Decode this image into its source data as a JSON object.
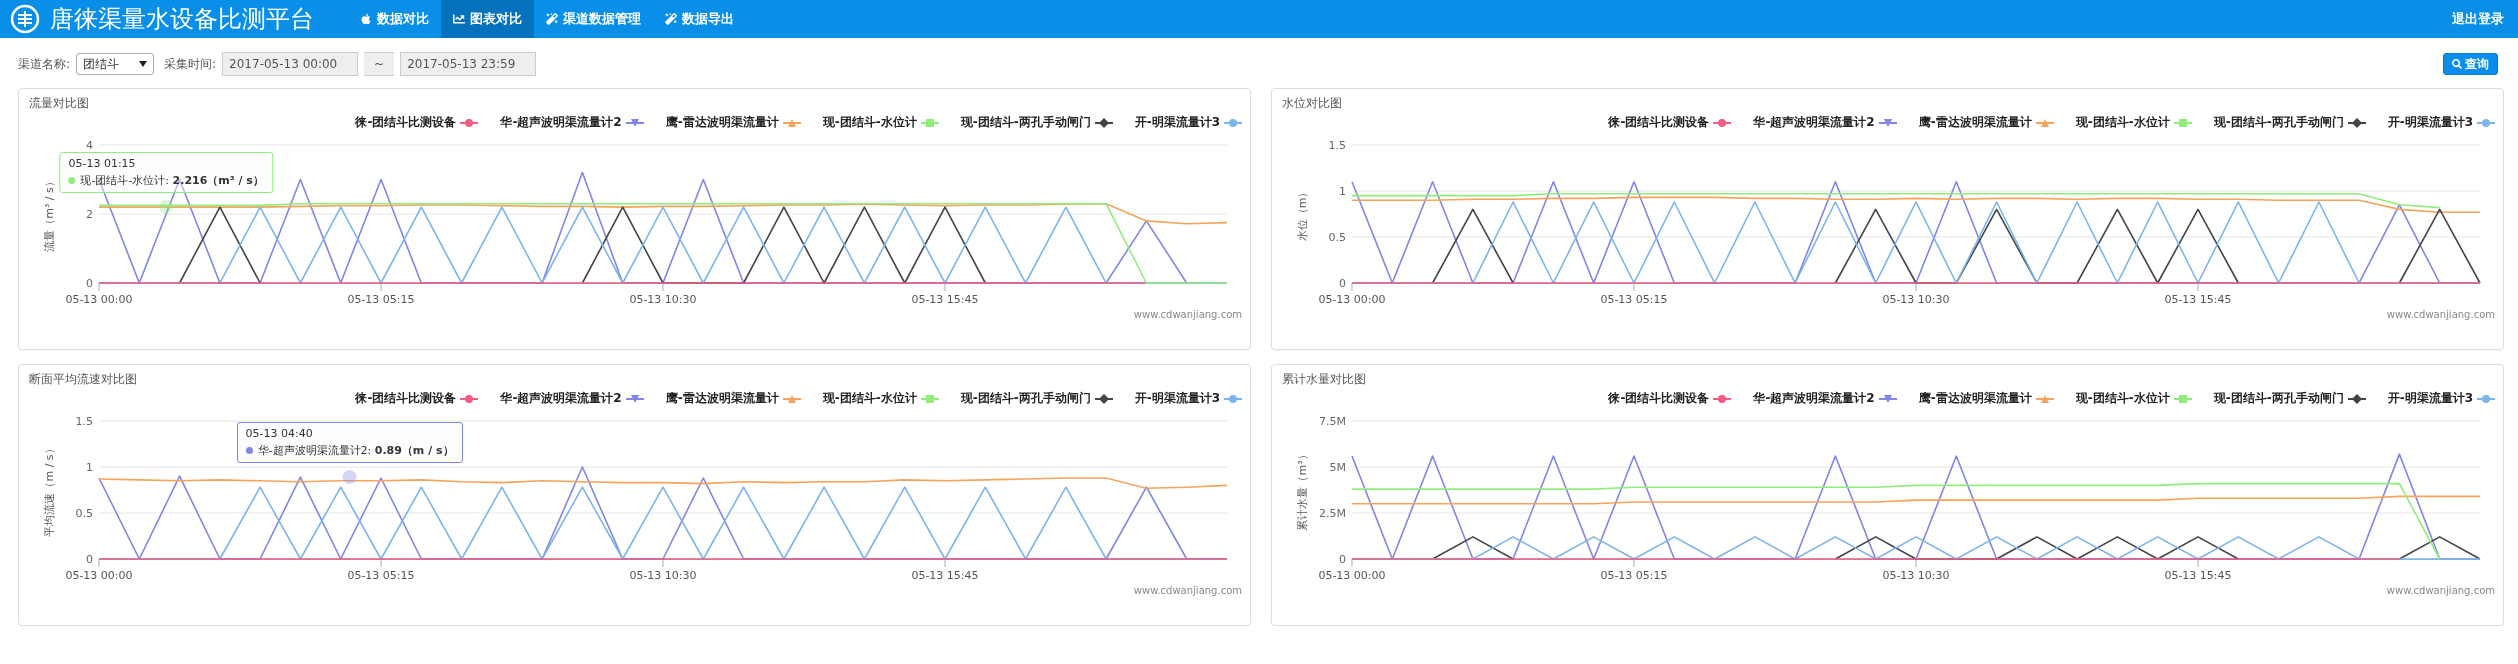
{
  "header": {
    "title": "唐徕渠量水设备比测平台",
    "nav": [
      {
        "label": "数据对比",
        "selected": false
      },
      {
        "label": "图表对比",
        "selected": true
      },
      {
        "label": "渠道数据管理",
        "selected": false
      },
      {
        "label": "数据导出",
        "selected": false
      }
    ],
    "logout": "退出登录"
  },
  "filters": {
    "channel_label": "渠道名称:",
    "channel_value": "团结斗",
    "time_label": "采集时间:",
    "start": "2017-05-13 00:00",
    "separator": "~",
    "end": "2017-05-13 23:59",
    "query_button": "查询"
  },
  "panels": [
    {
      "title": "流量对比图",
      "credits": "www.cdwanjiang.com",
      "tooltip": {
        "time": "05-13 01:15",
        "text": "现-团结斗-水位计: **2.216（m³ / s）**",
        "color": "#90ed7d"
      },
      "chart_data": {
        "type": "line",
        "ylabel": "流量（m³ / s）",
        "ylim": [
          0,
          4
        ],
        "yticks": [
          0,
          2,
          4
        ],
        "categories": [
          "05-13 00:00",
          null,
          null,
          null,
          null,
          null,
          null,
          "05-13 05:15",
          null,
          null,
          null,
          null,
          null,
          null,
          "05-13 10:30",
          null,
          null,
          null,
          null,
          null,
          null,
          "05-13 15:45",
          null,
          null,
          null,
          null,
          null,
          null,
          null
        ],
        "series": [
          {
            "name": "徕-团结斗比测设备",
            "color": "#f15c80",
            "values": [
              0,
              0,
              0,
              0,
              0,
              0,
              0,
              0,
              0,
              0,
              0,
              0,
              0,
              0,
              0,
              0,
              0,
              0,
              0,
              0,
              0,
              0,
              0,
              0,
              0,
              0,
              0,
              null,
              null
            ]
          },
          {
            "name": "华-超声波明渠流量计2",
            "color": "#8085e9",
            "values": [
              3,
              0,
              3,
              0,
              0,
              3,
              0,
              3,
              0,
              0,
              0,
              0,
              3.2,
              0,
              0,
              3,
              0,
              0,
              0,
              0,
              0,
              0,
              0,
              0,
              0,
              0,
              1.8,
              0,
              0
            ]
          },
          {
            "name": "鹰-雷达波明渠流量计",
            "color": "#f7a35c",
            "values": [
              2.2,
              2.2,
              2.2,
              2.2,
              2.2,
              2.22,
              2.24,
              2.24,
              2.26,
              2.26,
              2.24,
              2.22,
              2.22,
              2.2,
              2.22,
              2.22,
              2.24,
              2.26,
              2.26,
              2.28,
              2.26,
              2.24,
              2.26,
              2.26,
              2.28,
              2.3,
              1.8,
              1.72,
              1.75
            ]
          },
          {
            "name": "现-团结斗-水位计",
            "color": "#90ed7d",
            "values": [
              2.25,
              2.25,
              2.25,
              2.25,
              2.25,
              2.3,
              2.3,
              2.3,
              2.3,
              2.3,
              2.3,
              2.3,
              2.3,
              2.3,
              2.3,
              2.3,
              2.3,
              2.3,
              2.3,
              2.3,
              2.3,
              2.3,
              2.3,
              2.3,
              2.3,
              2.3,
              0,
              0,
              0
            ]
          },
          {
            "name": "现-团结斗-两孔手动闸门",
            "color": "#434348",
            "values": [
              null,
              null,
              0,
              2.2,
              0,
              null,
              null,
              null,
              null,
              null,
              null,
              null,
              0,
              2.2,
              0,
              0,
              0,
              2.2,
              0,
              2.2,
              0,
              2.2,
              0,
              null,
              null,
              null,
              null,
              null,
              null
            ]
          },
          {
            "name": "开-明渠流量计3",
            "color": "#7cb5ec",
            "values": [
              0,
              0,
              0,
              0,
              2.2,
              0,
              2.2,
              0,
              2.2,
              0,
              2.2,
              0,
              2.2,
              0,
              2.2,
              0,
              2.2,
              0,
              2.2,
              0,
              2.2,
              0,
              2.2,
              0,
              2.2,
              0,
              0,
              0,
              0
            ]
          }
        ]
      }
    },
    {
      "title": "水位对比图",
      "credits": "www.cdwanjiang.com",
      "chart_data": {
        "type": "line",
        "ylabel": "水位（m）",
        "ylim": [
          0,
          1.5
        ],
        "yticks": [
          0,
          0.5,
          1,
          1.5
        ],
        "categories": [
          "05-13 00:00",
          null,
          null,
          null,
          null,
          null,
          null,
          "05-13 05:15",
          null,
          null,
          null,
          null,
          null,
          null,
          "05-13 10:30",
          null,
          null,
          null,
          null,
          null,
          null,
          "05-13 15:45",
          null,
          null,
          null,
          null,
          null,
          null,
          null
        ],
        "series": [
          {
            "name": "徕-团结斗比测设备",
            "color": "#f15c80",
            "values": [
              0,
              0,
              0,
              0,
              0,
              0,
              0,
              0,
              0,
              0,
              0,
              0,
              0,
              0,
              0,
              0,
              0,
              0,
              0,
              0,
              0,
              0,
              0,
              0,
              0,
              0,
              0,
              0,
              0
            ]
          },
          {
            "name": "华-超声波明渠流量计2",
            "color": "#8085e9",
            "values": [
              1.1,
              0,
              1.1,
              0,
              0,
              1.1,
              0,
              1.1,
              0,
              0,
              0,
              0,
              1.1,
              0,
              0,
              1.1,
              0,
              0,
              0,
              0,
              0,
              0,
              0,
              0,
              0,
              0,
              0.85,
              0,
              0
            ]
          },
          {
            "name": "鹰-雷达波明渠流量计",
            "color": "#f7a35c",
            "values": [
              0.9,
              0.9,
              0.9,
              0.91,
              0.91,
              0.92,
              0.92,
              0.93,
              0.93,
              0.93,
              0.92,
              0.92,
              0.91,
              0.91,
              0.92,
              0.91,
              0.92,
              0.92,
              0.91,
              0.92,
              0.92,
              0.91,
              0.91,
              0.9,
              0.9,
              0.9,
              0.8,
              0.77,
              0.77
            ]
          },
          {
            "name": "现-团结斗-水位计",
            "color": "#90ed7d",
            "values": [
              0.95,
              0.95,
              0.95,
              0.95,
              0.95,
              0.97,
              0.97,
              0.97,
              0.97,
              0.97,
              0.97,
              0.97,
              0.97,
              0.97,
              0.97,
              0.97,
              0.97,
              0.97,
              0.97,
              0.97,
              0.97,
              0.97,
              0.97,
              0.97,
              0.97,
              0.97,
              0.85,
              0.82,
              null
            ]
          },
          {
            "name": "现-团结斗-两孔手动闸门",
            "color": "#434348",
            "values": [
              null,
              null,
              0,
              0.8,
              0,
              null,
              null,
              null,
              null,
              null,
              null,
              null,
              0,
              0.8,
              0,
              0,
              0.8,
              0,
              0,
              0.8,
              0,
              0.8,
              0,
              null,
              null,
              null,
              0,
              0.8,
              0
            ]
          },
          {
            "name": "开-明渠流量计3",
            "color": "#7cb5ec",
            "values": [
              0,
              0,
              0,
              0,
              0.88,
              0,
              0.88,
              0,
              0.88,
              0,
              0.88,
              0,
              0.88,
              0,
              0.88,
              0,
              0.88,
              0,
              0.88,
              0,
              0.88,
              0,
              0.88,
              0,
              0.88,
              0,
              0,
              0,
              0
            ]
          }
        ]
      }
    },
    {
      "title": "断面平均流速对比图",
      "credits": "www.cdwanjiang.com",
      "tooltip": {
        "time": "05-13 04:40",
        "text": "华-超声波明渠流量计2: **0.89（m / s）**",
        "color": "#8085e9"
      },
      "chart_data": {
        "type": "line",
        "ylabel": "平均流速（m / s）",
        "ylim": [
          0,
          1.5
        ],
        "yticks": [
          0,
          0.5,
          1,
          1.5
        ],
        "categories": [
          "05-13 00:00",
          null,
          null,
          null,
          null,
          null,
          null,
          "05-13 05:15",
          null,
          null,
          null,
          null,
          null,
          null,
          "05-13 10:30",
          null,
          null,
          null,
          null,
          null,
          null,
          "05-13 15:45",
          null,
          null,
          null,
          null,
          null,
          null,
          null
        ],
        "series": [
          {
            "name": "徕-团结斗比测设备",
            "color": "#f15c80",
            "values": [
              0,
              0,
              0,
              0,
              0,
              0,
              0,
              0,
              0,
              0,
              0,
              0,
              0,
              0,
              0,
              0,
              0,
              0,
              0,
              0,
              0,
              0,
              0,
              0,
              0,
              0,
              0,
              0,
              0
            ]
          },
          {
            "name": "华-超声波明渠流量计2",
            "color": "#8085e9",
            "values": [
              0.88,
              0,
              0.9,
              0,
              0,
              0.89,
              0,
              0.88,
              0,
              0,
              0,
              0,
              1,
              0,
              0,
              0.88,
              0,
              0,
              0,
              0,
              0,
              0,
              0,
              0,
              0,
              0,
              0.78,
              0,
              0
            ]
          },
          {
            "name": "鹰-雷达波明渠流量计",
            "color": "#f7a35c",
            "values": [
              0.87,
              0.86,
              0.85,
              0.86,
              0.85,
              0.84,
              0.85,
              0.85,
              0.86,
              0.84,
              0.83,
              0.85,
              0.84,
              0.83,
              0.83,
              0.82,
              0.84,
              0.83,
              0.84,
              0.84,
              0.86,
              0.85,
              0.86,
              0.87,
              0.88,
              0.88,
              0.77,
              0.78,
              0.8
            ]
          },
          {
            "name": "现-团结斗-水位计",
            "color": "#90ed7d",
            "values": [
              null,
              null,
              null,
              null,
              null,
              null,
              null,
              null,
              null,
              null,
              null,
              null,
              null,
              null,
              null,
              null,
              null,
              null,
              null,
              null,
              null,
              null,
              null,
              null,
              null,
              null,
              null,
              null,
              null
            ]
          },
          {
            "name": "现-团结斗-两孔手动闸门",
            "color": "#434348",
            "values": [
              null,
              null,
              null,
              null,
              null,
              null,
              null,
              null,
              null,
              null,
              null,
              null,
              null,
              null,
              null,
              null,
              null,
              null,
              null,
              null,
              null,
              null,
              null,
              null,
              null,
              null,
              null,
              null,
              null
            ]
          },
          {
            "name": "开-明渠流量计3",
            "color": "#7cb5ec",
            "values": [
              0,
              0,
              0,
              0,
              0.78,
              0,
              0.78,
              0,
              0.78,
              0,
              0.78,
              0,
              0.78,
              0,
              0.78,
              0,
              0.78,
              0,
              0.78,
              0,
              0.78,
              0,
              0.78,
              0,
              0.78,
              0,
              0,
              0,
              0
            ]
          }
        ]
      }
    },
    {
      "title": "累计水量对比图",
      "credits": "www.cdwanjiang.com",
      "chart_data": {
        "type": "line",
        "ylabel": "累计水量（m³）",
        "ylim": [
          0,
          7.5
        ],
        "yticks": [
          {
            "value": 0,
            "label": "0"
          },
          {
            "value": 2.5,
            "label": "2.5M"
          },
          {
            "value": 5,
            "label": "5M"
          },
          {
            "value": 7.5,
            "label": "7.5M"
          }
        ],
        "categories": [
          "05-13 00:00",
          null,
          null,
          null,
          null,
          null,
          null,
          "05-13 05:15",
          null,
          null,
          null,
          null,
          null,
          null,
          "05-13 10:30",
          null,
          null,
          null,
          null,
          null,
          null,
          "05-13 15:45",
          null,
          null,
          null,
          null,
          null,
          null,
          null
        ],
        "series": [
          {
            "name": "徕-团结斗比测设备",
            "color": "#f15c80",
            "values": [
              0,
              0,
              0,
              0,
              0,
              0,
              0,
              0,
              0,
              0,
              0,
              0,
              0,
              0,
              0,
              0,
              0,
              0,
              0,
              0,
              0,
              0,
              0,
              0,
              0,
              0,
              0,
              null,
              null
            ]
          },
          {
            "name": "华-超声波明渠流量计2",
            "color": "#8085e9",
            "values": [
              5.6,
              0,
              5.6,
              0,
              0,
              5.6,
              0,
              5.6,
              0,
              0,
              0,
              0,
              5.6,
              0,
              0,
              5.6,
              0,
              0,
              0,
              0,
              0,
              0,
              0,
              0,
              0,
              0,
              5.7,
              0,
              0
            ]
          },
          {
            "name": "鹰-雷达波明渠流量计",
            "color": "#f7a35c",
            "values": [
              3,
              3,
              3,
              3,
              3,
              3,
              3,
              3.1,
              3.1,
              3.1,
              3.1,
              3.1,
              3.1,
              3.1,
              3.2,
              3.2,
              3.2,
              3.2,
              3.2,
              3.2,
              3.2,
              3.3,
              3.3,
              3.3,
              3.3,
              3.3,
              3.4,
              3.4,
              3.4
            ]
          },
          {
            "name": "现-团结斗-水位计",
            "color": "#90ed7d",
            "values": [
              3.8,
              3.8,
              3.8,
              3.8,
              3.8,
              3.8,
              3.8,
              3.9,
              3.9,
              3.9,
              3.9,
              3.9,
              3.9,
              3.9,
              4,
              4,
              4,
              4,
              4,
              4,
              4,
              4.1,
              4.1,
              4.1,
              4.1,
              4.1,
              4.1,
              0,
              null
            ]
          },
          {
            "name": "现-团结斗-两孔手动闸门",
            "color": "#434348",
            "values": [
              null,
              null,
              0,
              1.2,
              0,
              null,
              null,
              null,
              null,
              null,
              null,
              null,
              0,
              1.2,
              0,
              0,
              0,
              1.2,
              0,
              1.2,
              0,
              1.2,
              0,
              null,
              null,
              null,
              0,
              1.2,
              0
            ]
          },
          {
            "name": "开-明渠流量计3",
            "color": "#7cb5ec",
            "values": [
              0,
              0,
              0,
              0,
              1.2,
              0,
              1.2,
              0,
              1.2,
              0,
              1.2,
              0,
              1.2,
              0,
              1.2,
              0,
              1.2,
              0,
              1.2,
              0,
              1.2,
              0,
              1.2,
              0,
              1.2,
              0,
              0,
              0,
              0
            ]
          }
        ]
      }
    }
  ]
}
